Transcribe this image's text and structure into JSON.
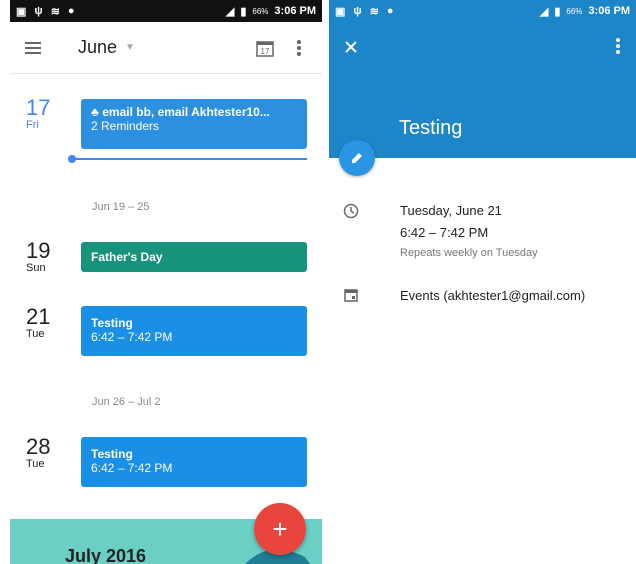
{
  "status_bar": {
    "battery_pct": "66%",
    "time": "3:06 PM"
  },
  "left": {
    "month": "June",
    "calendar_icon_day": "17",
    "entries": [
      {
        "day": "17",
        "dow": "Fri",
        "title": "email bb, email Akhtester10...",
        "sub": "2 Reminders"
      },
      {
        "range": "Jun 19 – 25"
      },
      {
        "day": "19",
        "dow": "Sun",
        "title": "Father's Day"
      },
      {
        "day": "21",
        "dow": "Tue",
        "title": "Testing",
        "sub": "6:42 – 7:42 PM"
      },
      {
        "range": "Jun 26 – Jul 2"
      },
      {
        "day": "28",
        "dow": "Tue",
        "title": "Testing",
        "sub": "6:42 – 7:42 PM"
      }
    ],
    "july_label": "July 2016",
    "fab_label": "+"
  },
  "right": {
    "title": "Testing",
    "date": "Tuesday, June 21",
    "time": "6:42 – 7:42 PM",
    "repeat": "Repeats weekly on Tuesday",
    "calendar": "Events (akhtester1@gmail.com)"
  },
  "colors": {
    "blue_event": "#1a8fe6",
    "green_event": "#16937a",
    "header_blue": "#1d86c8",
    "fab_red": "#e8453c",
    "today_blue": "#4285f4"
  }
}
